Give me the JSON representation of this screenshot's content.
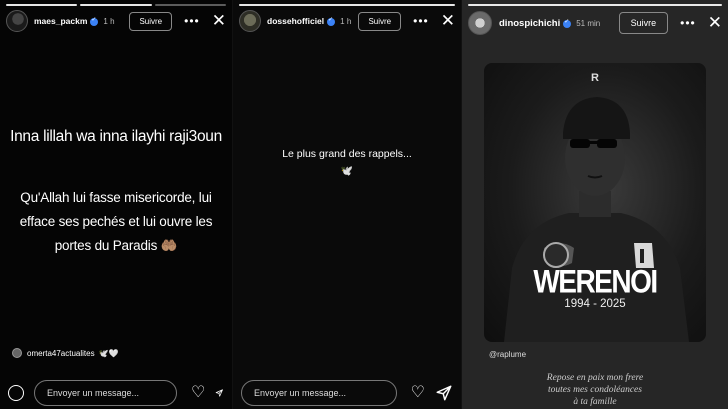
{
  "stories": [
    {
      "username": "maes_packm",
      "time": "1 h",
      "follow_label": "Suivre",
      "text_title": "Inna lillah wa inna ilayhi raji3oun",
      "text_body": "Qu'Allah lui fasse misericorde, lui efface ses pechés et lui ouvre les portes du Paradis",
      "text_emoji": "🤲🏽",
      "mention_user": "omerta47actualites",
      "mention_emoji": "🕊️🤍",
      "message_placeholder": "Envoyer un message..."
    },
    {
      "username": "dossehofficiel",
      "time": "1 h",
      "follow_label": "Suivre",
      "text_title": "Le plus grand des rappels...",
      "text_emoji": "🕊️",
      "message_placeholder": "Envoyer un message..."
    },
    {
      "username": "dinospichichi",
      "time": "51 min",
      "follow_label": "Suivre",
      "card_logo": "R",
      "card_name": "WERENOI",
      "card_years": "1994 - 2025",
      "credit": "@raplume",
      "caption_lines": [
        "Repose en paix mon frere",
        "toutes mes condoléances",
        "à ta famille"
      ]
    }
  ],
  "icons": {
    "more": "more-icon",
    "close": "close-icon",
    "heart": "heart-icon",
    "send": "send-icon",
    "camera": "camera-icon"
  }
}
